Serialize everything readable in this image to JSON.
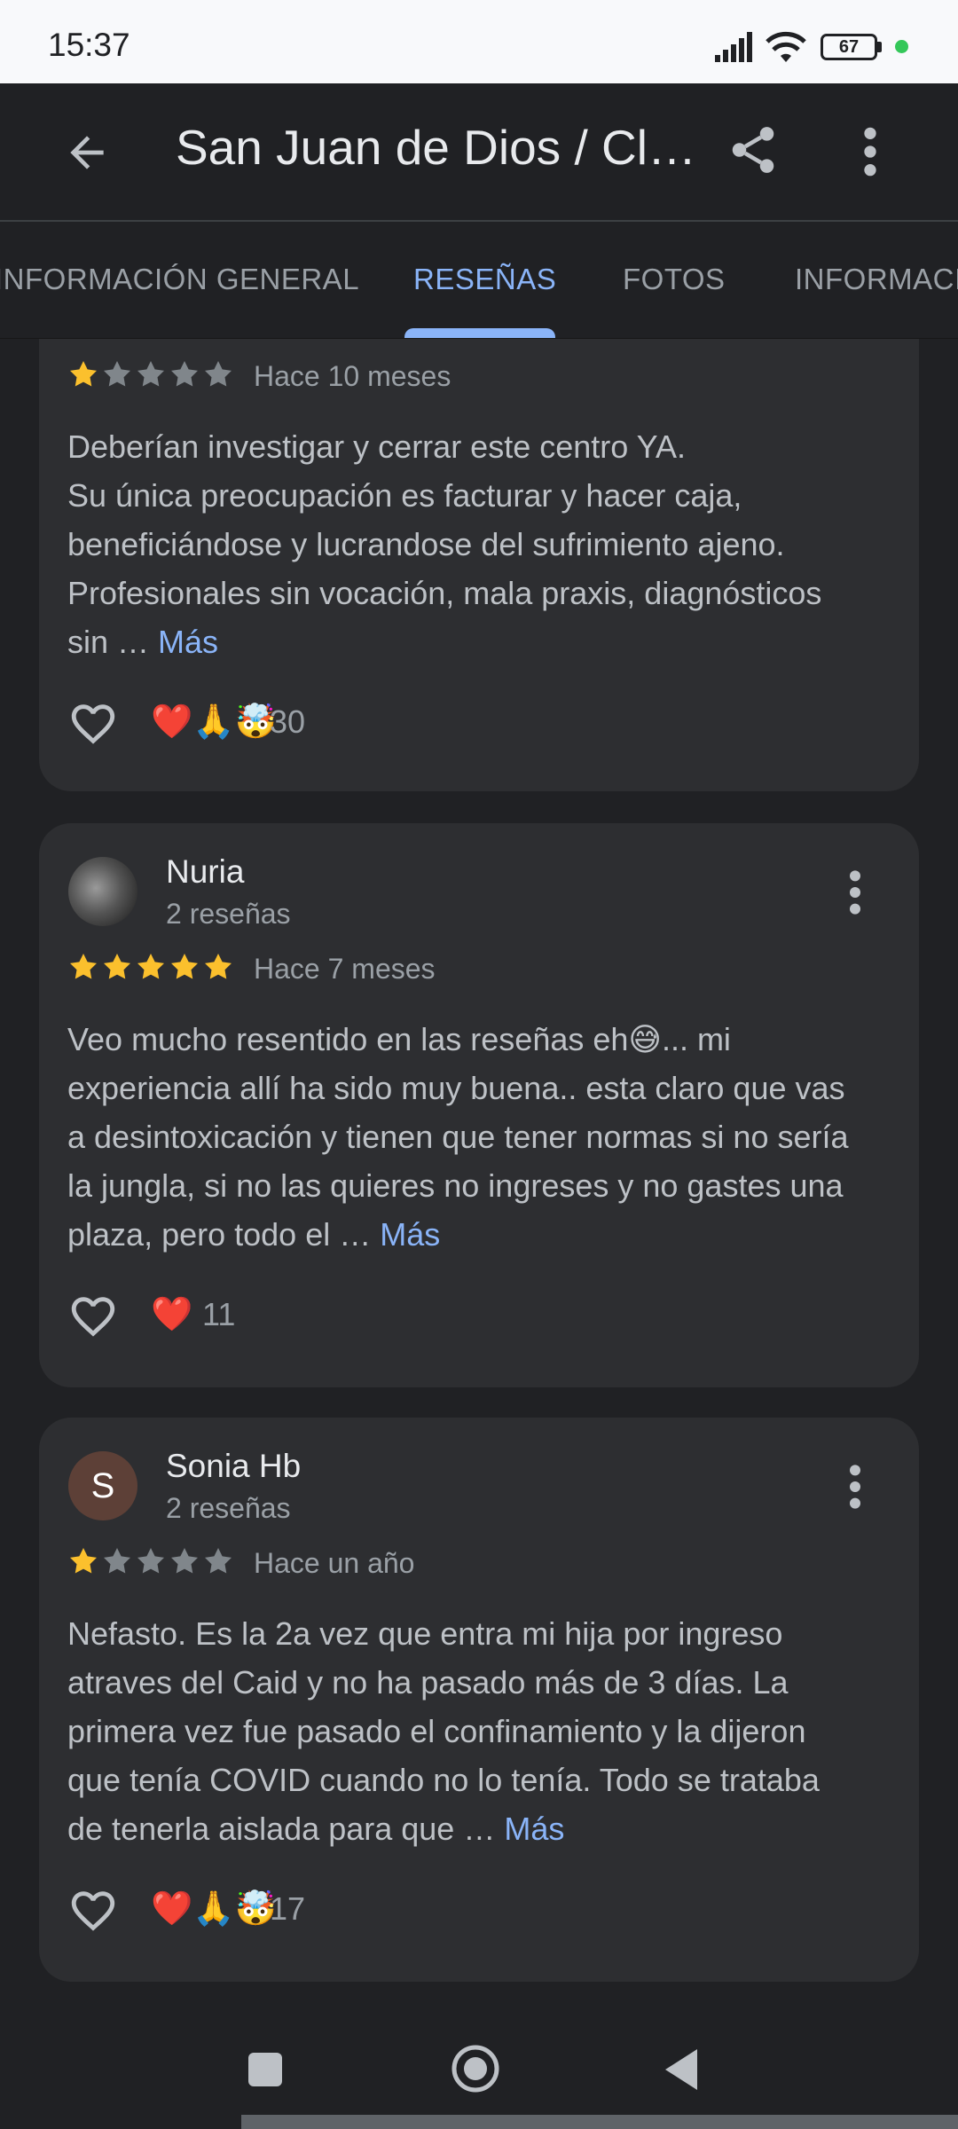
{
  "status_bar": {
    "time": "15:37",
    "battery": "67",
    "icons": [
      "signal-icon",
      "wifi-icon",
      "battery-icon",
      "privacy-dot"
    ]
  },
  "app_bar": {
    "back_icon": "arrow-back-icon",
    "title": "San Juan de Dios / Cl…",
    "share_icon": "share-icon",
    "more_icon": "more-vert-icon"
  },
  "tabs": [
    {
      "label": "INFORMACIÓN GENERAL",
      "selected": false
    },
    {
      "label": "RESEÑAS",
      "selected": true
    },
    {
      "label": "FOTOS",
      "selected": false
    },
    {
      "label": "INFORMACI",
      "selected": false
    }
  ],
  "colors": {
    "background": "#202124",
    "card": "#2d2e31",
    "accent": "#8ab4f8",
    "star_filled": "#fbc02d",
    "star_empty": "#80868b"
  },
  "reviews": [
    {
      "rating": 1,
      "date": "Hace 10 meses",
      "text_lines": [
        "Deberían investigar y cerrar este centro YA.",
        "Su única preocupación es facturar y hacer caja,",
        "beneficiándose y lucrandose del sufrimiento ajeno.",
        "Profesionales sin vocación, mala praxis, diagnósticos",
        "sin … "
      ],
      "more_label": "Más",
      "reactions": "❤️🙏🤯",
      "count": "30"
    },
    {
      "author": "Nuria",
      "sub": "2 reseñas",
      "rating": 5,
      "date": "Hace 7 meses",
      "text_lines": [
        "Veo mucho resentido en las reseñas eh😅... mi",
        "experiencia allí ha sido muy buena.. esta claro que vas",
        "a desintoxicación y tienen que tener normas si no sería",
        "la jungla, si no las quieres no ingreses y no gastes una",
        "plaza, pero todo el … "
      ],
      "more_label": "Más",
      "reactions": "❤️",
      "count": "11"
    },
    {
      "author": "Sonia Hb",
      "avatar_letter": "S",
      "sub": "2 reseñas",
      "rating": 1,
      "date": "Hace un año",
      "text_lines": [
        "Nefasto. Es la 2a vez que entra mi hija por ingreso",
        "atraves del Caid y no ha pasado más de 3 días. La",
        "primera vez fue pasado el confinamiento y la dijeron",
        "que tenía COVID cuando no lo tenía. Todo se trataba",
        "de tenerla aislada para que … "
      ],
      "more_label": "Más",
      "reactions": "❤️🙏🤯",
      "count": "17"
    }
  ]
}
